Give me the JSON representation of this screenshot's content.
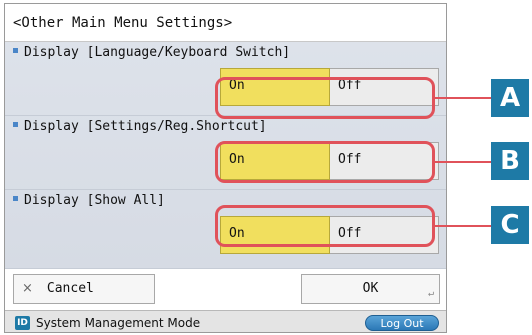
{
  "panel": {
    "title": "<Other Main Menu Settings>"
  },
  "settings": [
    {
      "label": "Display [Language/Keyboard Switch]",
      "on_label": "On",
      "off_label": "Off",
      "selected": "On"
    },
    {
      "label": "Display [Settings/Reg.Shortcut]",
      "on_label": "On",
      "off_label": "Off",
      "selected": "On"
    },
    {
      "label": "Display [Show All]",
      "on_label": "On",
      "off_label": "Off",
      "selected": "On"
    }
  ],
  "callouts": [
    "A",
    "B",
    "C"
  ],
  "footer": {
    "cancel_icon": "×",
    "cancel_label": "Cancel",
    "ok_label": "OK",
    "ok_corner_icon": "↵"
  },
  "status": {
    "badge": "ID",
    "mode_text": "System Management Mode",
    "logout_label": "Log Out"
  },
  "colors": {
    "selected_option": "#f1df5e",
    "callout_ring": "#e0525a",
    "callout_badge": "#1e7aa6"
  }
}
